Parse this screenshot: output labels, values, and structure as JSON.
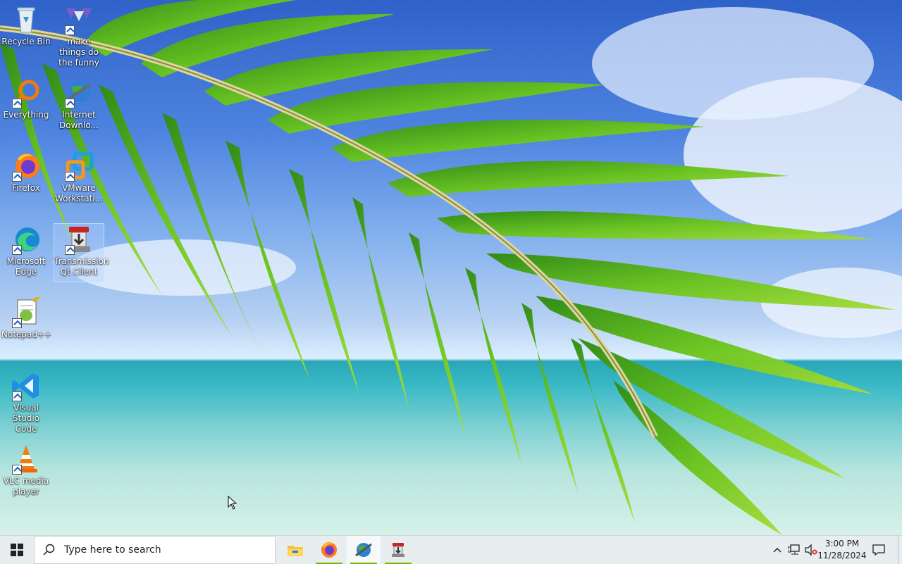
{
  "desktop": {
    "icons": [
      {
        "label": "Recycle Bin",
        "name": "recycle-bin"
      },
      {
        "label": "make things do the funny",
        "name": "make-things-do-the-funny"
      },
      {
        "label": "Everything",
        "name": "everything"
      },
      {
        "label": "Internet Downlo...",
        "name": "internet-download-manager"
      },
      {
        "label": "Firefox",
        "name": "firefox"
      },
      {
        "label": "VMware Workstati...",
        "name": "vmware-workstation"
      },
      {
        "label": "Microsoft Edge",
        "name": "microsoft-edge"
      },
      {
        "label": "Transmission Qt Client",
        "name": "transmission-qt-client"
      },
      {
        "label": "Notepad++",
        "name": "notepad-plus-plus"
      },
      {
        "label": "Visual Studio Code",
        "name": "visual-studio-code"
      },
      {
        "label": "VLC media player",
        "name": "vlc-media-player"
      }
    ]
  },
  "taskbar": {
    "search_placeholder": "Type here to search",
    "pinned": [
      "file-explorer-icon",
      "firefox-icon",
      "internet-download-manager-icon",
      "transmission-icon"
    ],
    "accent_color": "#76b900",
    "clock": {
      "time": "3:00 PM",
      "date": "11/28/2024"
    }
  },
  "colors": {
    "taskbar_bg": "#e8eef0",
    "desktop_text": "#ffffff"
  }
}
